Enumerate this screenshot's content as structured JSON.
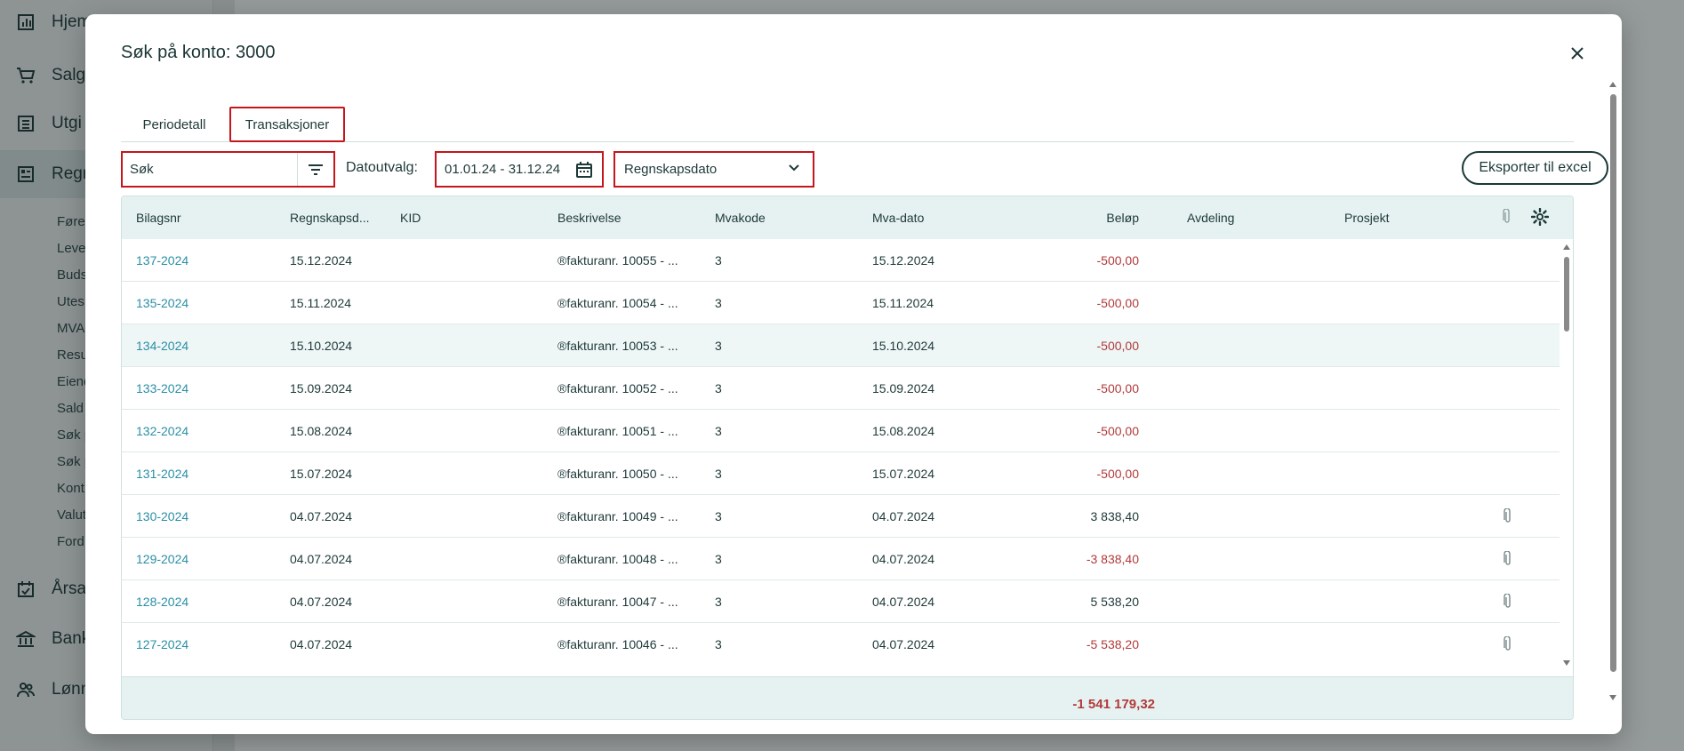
{
  "background": {
    "nav": [
      {
        "label": "Hjem",
        "icon": "bar-chart-icon"
      },
      {
        "label": "Salg",
        "icon": "cart-icon"
      },
      {
        "label": "Utgi",
        "icon": "receipt-icon"
      },
      {
        "label": "Regn",
        "icon": "ledger-icon"
      },
      {
        "label": "Årsa",
        "icon": "calendar-check-icon"
      },
      {
        "label": "Bank",
        "icon": "bank-icon"
      },
      {
        "label": "Lønn",
        "icon": "people-icon"
      }
    ],
    "sub": [
      "Føre",
      "Leve",
      "Buds",
      "Utes",
      "MVA",
      "Resu",
      "Eiend",
      "Sald",
      "Søk p",
      "Søk p",
      "Kont",
      "Valut",
      "Ford"
    ]
  },
  "modal": {
    "title": "Søk på konto: 3000",
    "tabs": [
      {
        "label": "Periodetall",
        "active": false
      },
      {
        "label": "Transaksjoner",
        "active": true
      }
    ],
    "filters": {
      "search_placeholder": "Søk",
      "date_label": "Datoutvalg:",
      "date_range": "01.01.24 - 31.12.24",
      "date_type": "Regnskapsdato",
      "export_label": "Eksporter til excel"
    },
    "columns": [
      "Bilagsnr",
      "Regnskapsd...",
      "KID",
      "Beskrivelse",
      "Mvakode",
      "Mva-dato",
      "Beløp",
      "Avdeling",
      "Prosjekt"
    ],
    "rows": [
      {
        "bilagsnr": "137-2024",
        "regnskapsdato": "15.12.2024",
        "beskrivelse": "®fakturanr. 10055 - ...",
        "mvakode": "3",
        "mvadato": "15.12.2024",
        "belop": "-500,00",
        "neg": true,
        "attachment": false
      },
      {
        "bilagsnr": "135-2024",
        "regnskapsdato": "15.11.2024",
        "beskrivelse": "®fakturanr. 10054 - ...",
        "mvakode": "3",
        "mvadato": "15.11.2024",
        "belop": "-500,00",
        "neg": true,
        "attachment": false
      },
      {
        "bilagsnr": "134-2024",
        "regnskapsdato": "15.10.2024",
        "beskrivelse": "®fakturanr. 10053 - ...",
        "mvakode": "3",
        "mvadato": "15.10.2024",
        "belop": "-500,00",
        "neg": true,
        "attachment": false
      },
      {
        "bilagsnr": "133-2024",
        "regnskapsdato": "15.09.2024",
        "beskrivelse": "®fakturanr. 10052 - ...",
        "mvakode": "3",
        "mvadato": "15.09.2024",
        "belop": "-500,00",
        "neg": true,
        "attachment": false
      },
      {
        "bilagsnr": "132-2024",
        "regnskapsdato": "15.08.2024",
        "beskrivelse": "®fakturanr. 10051 - ...",
        "mvakode": "3",
        "mvadato": "15.08.2024",
        "belop": "-500,00",
        "neg": true,
        "attachment": false
      },
      {
        "bilagsnr": "131-2024",
        "regnskapsdato": "15.07.2024",
        "beskrivelse": "®fakturanr. 10050 - ...",
        "mvakode": "3",
        "mvadato": "15.07.2024",
        "belop": "-500,00",
        "neg": true,
        "attachment": false
      },
      {
        "bilagsnr": "130-2024",
        "regnskapsdato": "04.07.2024",
        "beskrivelse": "®fakturanr. 10049 - ...",
        "mvakode": "3",
        "mvadato": "04.07.2024",
        "belop": "3 838,40",
        "neg": false,
        "attachment": true
      },
      {
        "bilagsnr": "129-2024",
        "regnskapsdato": "04.07.2024",
        "beskrivelse": "®fakturanr. 10048 - ...",
        "mvakode": "3",
        "mvadato": "04.07.2024",
        "belop": "-3 838,40",
        "neg": true,
        "attachment": true
      },
      {
        "bilagsnr": "128-2024",
        "regnskapsdato": "04.07.2024",
        "beskrivelse": "®fakturanr. 10047 - ...",
        "mvakode": "3",
        "mvadato": "04.07.2024",
        "belop": "5 538,20",
        "neg": false,
        "attachment": true
      },
      {
        "bilagsnr": "127-2024",
        "regnskapsdato": "04.07.2024",
        "beskrivelse": "®fakturanr. 10046 - ...",
        "mvakode": "3",
        "mvadato": "04.07.2024",
        "belop": "-5 538,20",
        "neg": true,
        "attachment": true
      }
    ],
    "total": "-1 541 179,32"
  },
  "colors": {
    "accent_red": "#c4161c",
    "link": "#2a8fa7",
    "negative": "#b23a3a",
    "header_bg": "#e6f2f2"
  }
}
